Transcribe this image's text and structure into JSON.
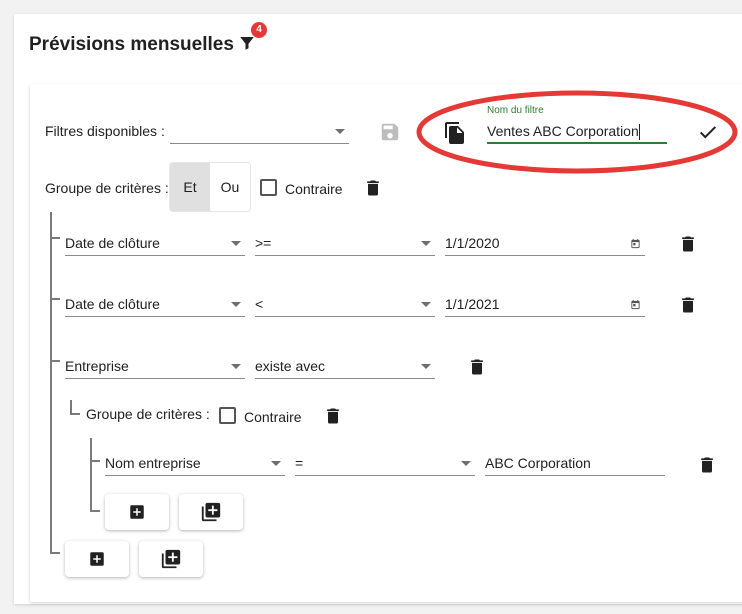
{
  "header": {
    "title": "Prévisions mensuelles",
    "filter_badge": "4"
  },
  "filters": {
    "available_label": "Filtres disponibles :",
    "available_value": "",
    "name_label": "Nom du filtre",
    "name_value": "Ventes ABC Corporation",
    "accent_color": "#2e7d32",
    "annotation_color": "#e53935"
  },
  "group": {
    "label": "Groupe de critères :",
    "and_label": "Et",
    "or_label": "Ou",
    "contrary_label": "Contraire"
  },
  "criteria": [
    {
      "field": "Date de clôture",
      "operator": ">=",
      "value": "1/1/2020"
    },
    {
      "field": "Date de clôture",
      "operator": "<",
      "value": "1/1/2021"
    },
    {
      "field": "Entreprise",
      "operator": "existe avec",
      "value": ""
    }
  ],
  "subgroup": {
    "label": "Groupe de critères :",
    "contrary_label": "Contraire",
    "criterion": {
      "field": "Nom entreprise",
      "operator": "=",
      "value": "ABC Corporation"
    }
  }
}
